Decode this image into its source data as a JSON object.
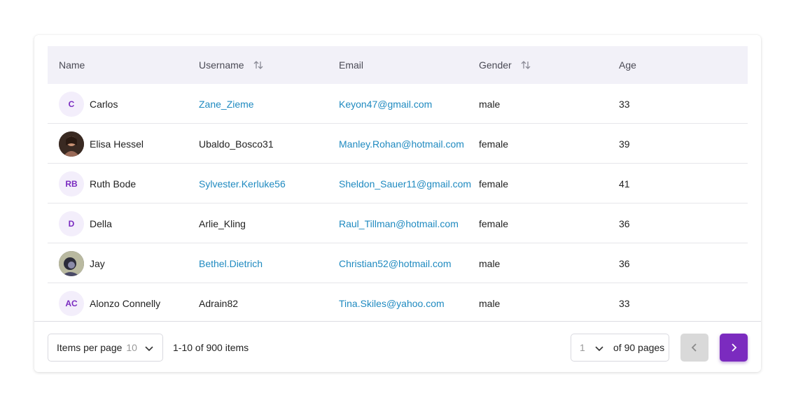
{
  "columns": {
    "name": "Name",
    "username": "Username",
    "email": "Email",
    "gender": "Gender",
    "age": "Age"
  },
  "rows": [
    {
      "initials": "C",
      "photo": false,
      "name": "Carlos",
      "username": "Zane_Zieme",
      "username_link": true,
      "email": "Keyon47@gmail.com",
      "gender": "male",
      "age": "33"
    },
    {
      "initials": "",
      "photo": true,
      "name": "Elisa Hessel",
      "username": "Ubaldo_Bosco31",
      "username_link": false,
      "email": "Manley.Rohan@hotmail.com",
      "gender": "female",
      "age": "39"
    },
    {
      "initials": "RB",
      "photo": false,
      "name": "Ruth Bode",
      "username": "Sylvester.Kerluke56",
      "username_link": true,
      "email": "Sheldon_Sauer11@gmail.com",
      "gender": "female",
      "age": "41"
    },
    {
      "initials": "D",
      "photo": false,
      "name": "Della",
      "username": "Arlie_Kling",
      "username_link": false,
      "email": "Raul_Tillman@hotmail.com",
      "gender": "female",
      "age": "36"
    },
    {
      "initials": "",
      "photo": true,
      "name": "Jay",
      "username": "Bethel.Dietrich",
      "username_link": true,
      "email": "Christian52@hotmail.com",
      "gender": "male",
      "age": "36"
    },
    {
      "initials": "AC",
      "photo": false,
      "name": "Alonzo Connelly",
      "username": "Adrain82",
      "username_link": false,
      "email": "Tina.Skiles@yahoo.com",
      "gender": "male",
      "age": "33"
    }
  ],
  "footer": {
    "items_per_page_label": "Items per page",
    "items_per_page_value": "10",
    "range_text": "1-10 of 900 items",
    "current_page": "1",
    "page_total_text": "of 90 pages"
  },
  "colors": {
    "accent": "#7b2bbf",
    "link": "#1f8ac0",
    "header_bg": "#f2f1f8"
  },
  "icons": {
    "sort": "sort-arrows-icon",
    "chevron_down": "chevron-down-icon",
    "prev": "chevron-left-icon",
    "next": "chevron-right-icon"
  }
}
